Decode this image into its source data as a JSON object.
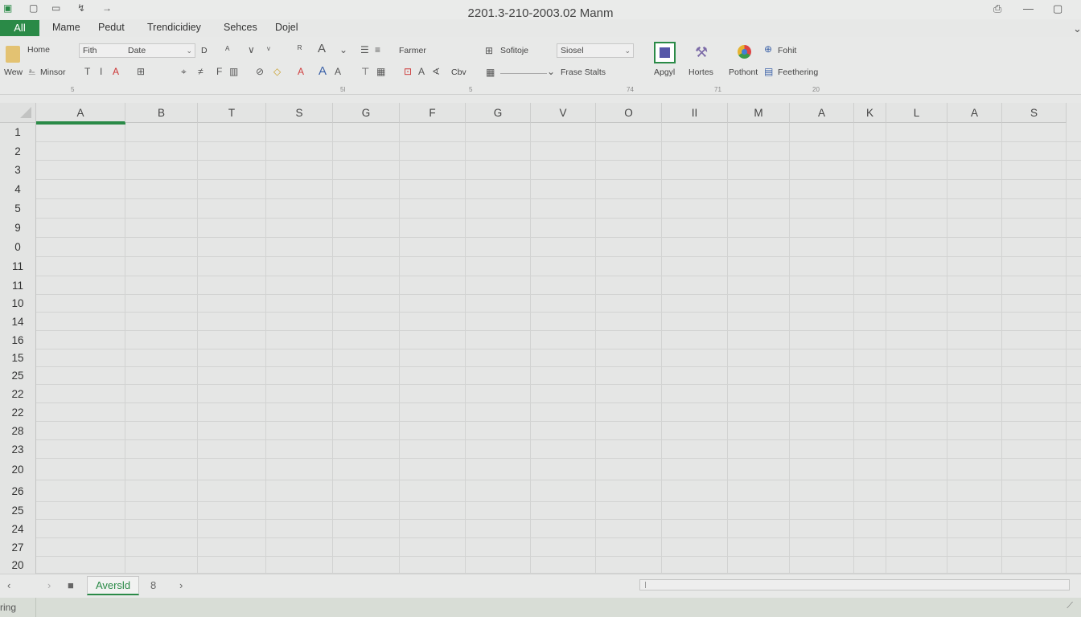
{
  "title_bar": {
    "title": "2201.3-210-2003.02 Manm",
    "quick_access": [
      "▣",
      "▢",
      "▭",
      "↯",
      "→"
    ]
  },
  "tabs": [
    {
      "label": "All"
    },
    {
      "label": "Mame"
    },
    {
      "label": "Pedut"
    },
    {
      "label": "Trendicidiey"
    },
    {
      "label": "Sehces"
    },
    {
      "label": "Dojel"
    }
  ],
  "ribbon": {
    "clipboard": {
      "home_label": "Home",
      "view_label": "Wew",
      "minsor_label": "Minsor"
    },
    "font": {
      "font_name": "Fith",
      "font_size": "Date",
      "font_size_mark": "D"
    },
    "alignment": {
      "format_label": "Farmer",
      "cbv_label": "Cbv"
    },
    "number": {
      "sofitoje_label": "Sofitoje",
      "number_format": "Siosel",
      "frase_stalts_label": "Frase Stalts"
    },
    "buttons": {
      "apgyl_label": "Apgyl",
      "hortes_label": "Hortes",
      "pothont_label": "Pothont",
      "fohit_label": "Fohit",
      "feethering_label": "Feethering"
    },
    "group_labels": [
      "5",
      "5l",
      "5",
      "74",
      "71",
      "20"
    ]
  },
  "grid": {
    "columns": [
      "A",
      "B",
      "T",
      "S",
      "G",
      "F",
      "G",
      "V",
      "O",
      "II",
      "M",
      "A",
      "K",
      "L",
      "A",
      "S"
    ],
    "rows": [
      "1",
      "2",
      "3",
      "4",
      "5",
      "9",
      "0",
      "11",
      "11",
      "10",
      "14",
      "16",
      "15",
      "25",
      "22",
      "22",
      "28",
      "23",
      "20",
      "26",
      "25",
      "24",
      "27",
      "20"
    ]
  },
  "sheets": {
    "active": "Aversld",
    "other": "8"
  },
  "status": {
    "text": "ring"
  },
  "colors": {
    "accent": "#2a8a47",
    "background": "#e7e8e7"
  }
}
